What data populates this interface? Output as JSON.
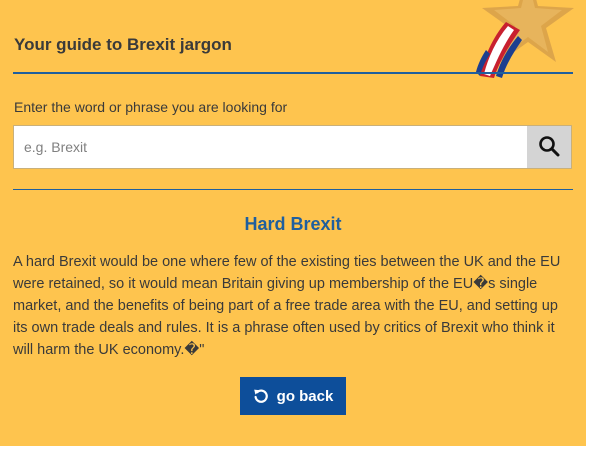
{
  "header": {
    "title": "Your guide to Brexit jargon"
  },
  "search": {
    "prompt": "Enter the word or phrase you are looking for",
    "placeholder": "e.g. Brexit",
    "value": "",
    "button_icon": "search-icon"
  },
  "entry": {
    "term": "Hard Brexit",
    "definition": "A hard Brexit would be one where few of the existing ties between the UK and the EU were retained, so it would mean Britain giving up membership of the EU�s single market, and the benefits of being part of a free trade area with the EU, and setting up its own trade deals and rules. It is a phrase often used by critics of Brexit who think it will harm the UK economy.�\""
  },
  "actions": {
    "back_label": "go back",
    "back_icon": "undo-icon"
  },
  "colors": {
    "background": "#fec44e",
    "accent_blue": "#1f5f9e",
    "button_blue": "#0d4e9a",
    "text": "#3a3a3a"
  }
}
